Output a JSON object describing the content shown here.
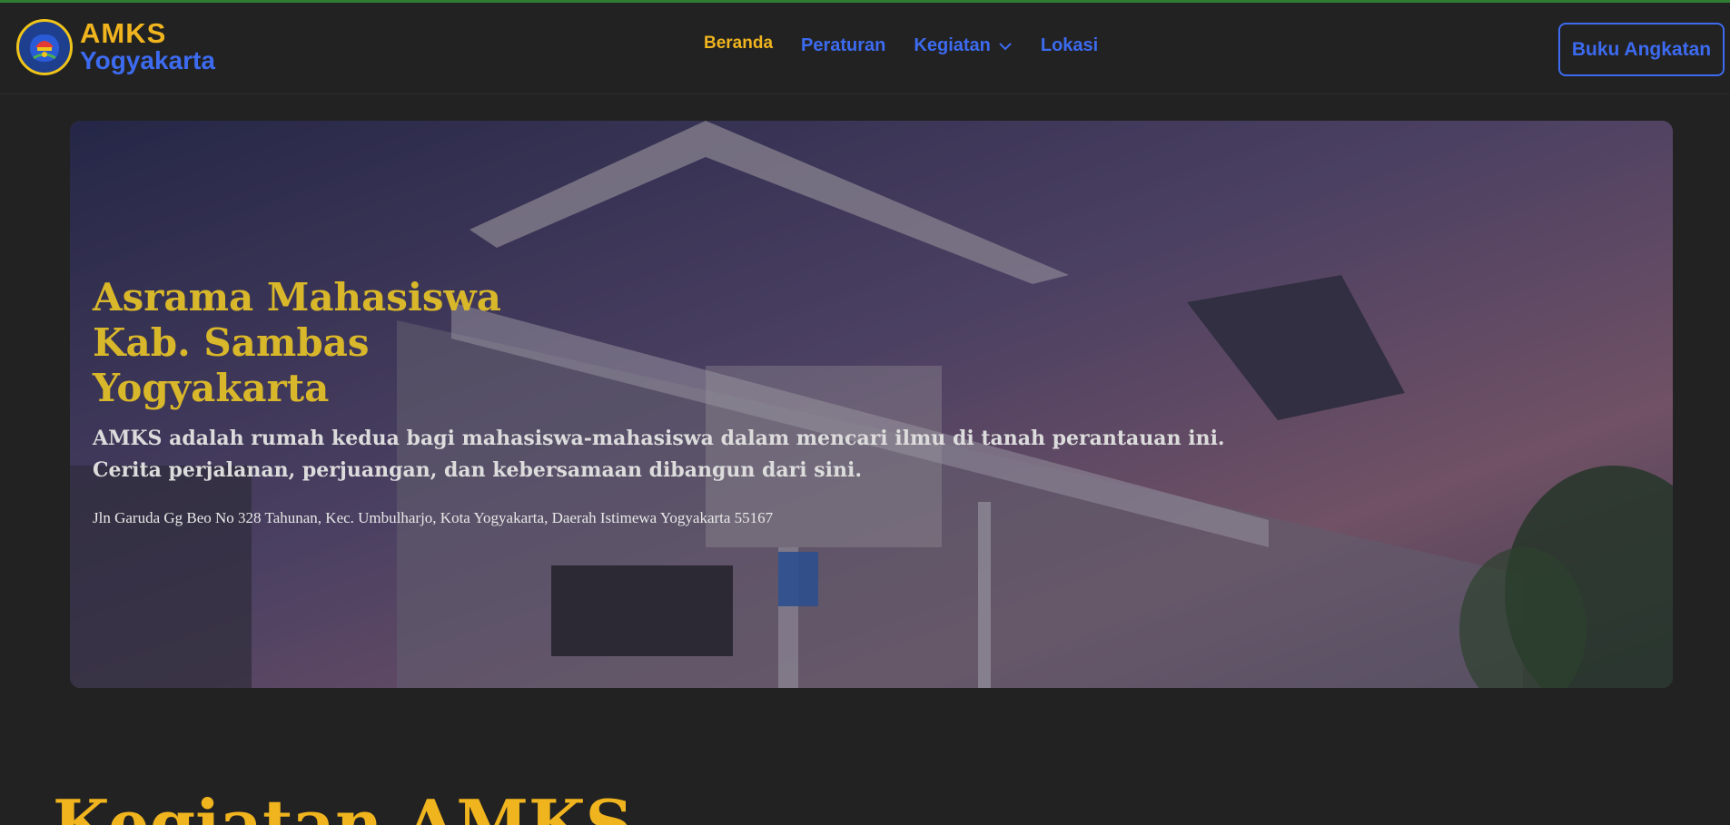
{
  "brand": {
    "line1": "AMKS",
    "line2": "Yogyakarta"
  },
  "nav": {
    "items": [
      {
        "label": "Beranda",
        "active": true
      },
      {
        "label": "Peraturan"
      },
      {
        "label": "Kegiatan",
        "has_dropdown": true
      },
      {
        "label": "Lokasi"
      }
    ]
  },
  "cta": {
    "label": "Buku Angkatan"
  },
  "hero": {
    "title_lines": [
      "Asrama Mahasiswa",
      "Kab. Sambas",
      "Yogyakarta"
    ],
    "description_lines": [
      "AMKS adalah rumah kedua bagi mahasiswa-mahasiswa dalam mencari ilmu di tanah perantauan ini.",
      "Cerita perjalanan, perjuangan, dan kebersamaan dibangun dari sini."
    ],
    "address": "Jln Garuda Gg Beo No 328 Tahunan, Kec. Umbulharjo, Kota Yogyakarta, Daerah Istimewa Yogyakarta 55167"
  },
  "section": {
    "title": "Kegiatan AMKS"
  },
  "colors": {
    "background": "#222222",
    "accent_gold": "#f0b41e",
    "accent_blue": "#3d6bf0",
    "hero_title": "#d9b72a"
  },
  "icons": {
    "logo": "amks-logo-icon",
    "dropdown": "chevron-down-icon"
  }
}
